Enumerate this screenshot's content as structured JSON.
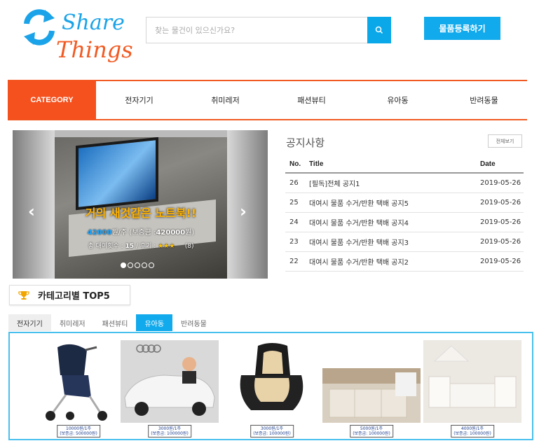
{
  "header": {
    "logo_line1": "Share",
    "logo_line2": "Things",
    "search_placeholder": "찾는 물건이 있으신가요?",
    "register_button": "물품등록하기"
  },
  "nav": {
    "category_label": "CATEGORY",
    "items": [
      "전자기기",
      "취미레저",
      "패션뷰티",
      "유아동",
      "반려동물"
    ]
  },
  "carousel": {
    "title": "거의 새것같은 노트북!!",
    "price_value": "42000",
    "price_suffix": "원/주 (보증금 :",
    "deposit_value": "420000",
    "deposit_suffix": "원)",
    "rent_label": "총 대여횟수 :",
    "rent_count": "15",
    "review_label": "/ 후기 :",
    "stars": "★★★",
    "review_count": "(8)",
    "prev": "‹",
    "next": "›"
  },
  "notice": {
    "title": "공지사항",
    "view_all": "전체보기",
    "columns": [
      "No.",
      "Title",
      "Date"
    ],
    "rows": [
      {
        "no": "26",
        "title": "[필독]전체 공지1",
        "date": "2019-05-26"
      },
      {
        "no": "25",
        "title": "대여시 물품 수거/반환 택배 공지5",
        "date": "2019-05-26"
      },
      {
        "no": "24",
        "title": "대여시 물품 수거/반환 택배 공지4",
        "date": "2019-05-26"
      },
      {
        "no": "23",
        "title": "대여시 물품 수거/반환 택배 공지3",
        "date": "2019-05-26"
      },
      {
        "no": "22",
        "title": "대여시 물품 수거/반환 택배 공지2",
        "date": "2019-05-26"
      }
    ]
  },
  "top5": {
    "title": "카테고리별 TOP5",
    "tabs": [
      "전자기기",
      "취미레저",
      "패션뷰티",
      "유아동",
      "반려동물"
    ],
    "active_tab": 3,
    "products": [
      {
        "price": "10000원/1주",
        "deposit": "(보증금: 500000원)"
      },
      {
        "price": "3000원/1주",
        "deposit": "(보증금: 100000원)"
      },
      {
        "price": "3000원/1주",
        "deposit": "(보증금: 100000원)"
      },
      {
        "price": "5000원/1주",
        "deposit": "(보증금: 100000원)"
      },
      {
        "price": "4000원/1주",
        "deposit": "(보증금: 100000원)"
      }
    ]
  },
  "colors": {
    "accent_blue": "#11aaec",
    "accent_orange": "#f4511e"
  }
}
